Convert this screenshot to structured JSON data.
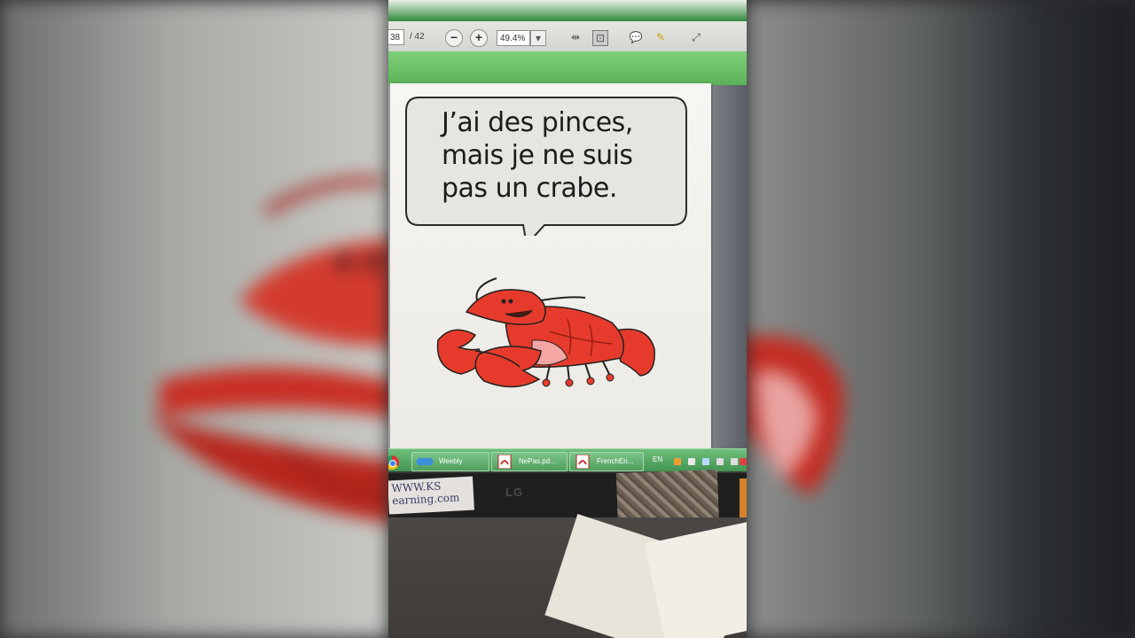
{
  "pdf_toolbar": {
    "page_current": "38",
    "page_total": "/ 42",
    "zoom_out_icon": "minus",
    "zoom_in_icon": "plus",
    "zoom_value": "49.4%"
  },
  "document": {
    "bubble_lines": [
      "J’ai des pinces,",
      "mais je ne suis",
      "pas un crabe."
    ],
    "illustration": "red lobster cartoon"
  },
  "taskbar": {
    "items": [
      {
        "label": "Weebly",
        "icon": "weebly-icon"
      },
      {
        "label": "NePas.pd...",
        "icon": "pdf-icon"
      },
      {
        "label": "FrenchEn...",
        "icon": "pdf-icon"
      }
    ],
    "language": "EN"
  },
  "monitor": {
    "brand": "LG"
  },
  "sticker": {
    "lines": [
      "WWW.KS",
      "earning.com"
    ]
  },
  "colors": {
    "lobster_red": "#e63b2c",
    "taskbar_green": "#4f9e5c",
    "toolbar_green": "#5cb258"
  }
}
